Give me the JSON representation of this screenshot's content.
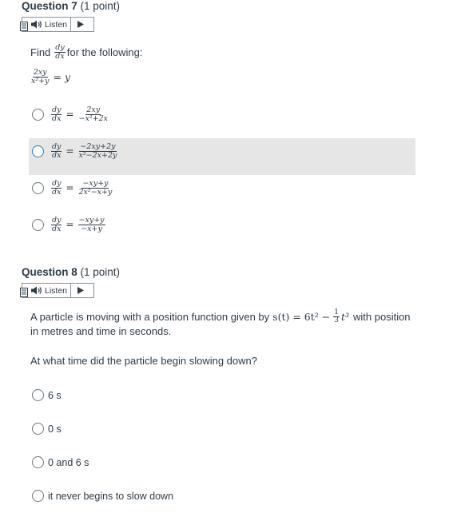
{
  "q7": {
    "title": "Question 7",
    "points": "(1 point)",
    "listen_label": "Listen",
    "find_word": "Find",
    "deriv_num": "dy",
    "deriv_den": "dx",
    "prompt_rest": "for the following:",
    "equation": {
      "num": "2xy",
      "den": "x²+y",
      "rhs": "= y"
    },
    "options": [
      {
        "lhs_num": "dy",
        "lhs_den": "dx",
        "eq": "=",
        "num": "2xy",
        "den": "−x²+2x"
      },
      {
        "lhs_num": "dy",
        "lhs_den": "dx",
        "eq": "=",
        "num": "−2xy+2y",
        "den": "x²−2x+2y"
      },
      {
        "lhs_num": "dy",
        "lhs_den": "dx",
        "eq": "=",
        "num": "−xy+y",
        "den": "2x²−x+y"
      },
      {
        "lhs_num": "dy",
        "lhs_den": "dx",
        "eq": "=",
        "num": "−xy+y",
        "den": "−x+y"
      }
    ]
  },
  "q8": {
    "title": "Question 8",
    "points": "(1 point)",
    "listen_label": "Listen",
    "text_before": "A particle is moving with a position function given by",
    "func_lhs": "s(t) = 6t² −",
    "frac_num": "1",
    "frac_den": "3",
    "func_rhs": "t³",
    "text_after": "with position",
    "text_line2": "in metres and time in seconds.",
    "question": "At what time did the particle begin slowing down?",
    "options": [
      "6 s",
      "0 s",
      "0 and 6 s",
      "it never begins to slow down"
    ]
  },
  "colors": {
    "text": "#2d3b45",
    "focus": "#2b7abc",
    "highlight": "#e6e6e6"
  }
}
